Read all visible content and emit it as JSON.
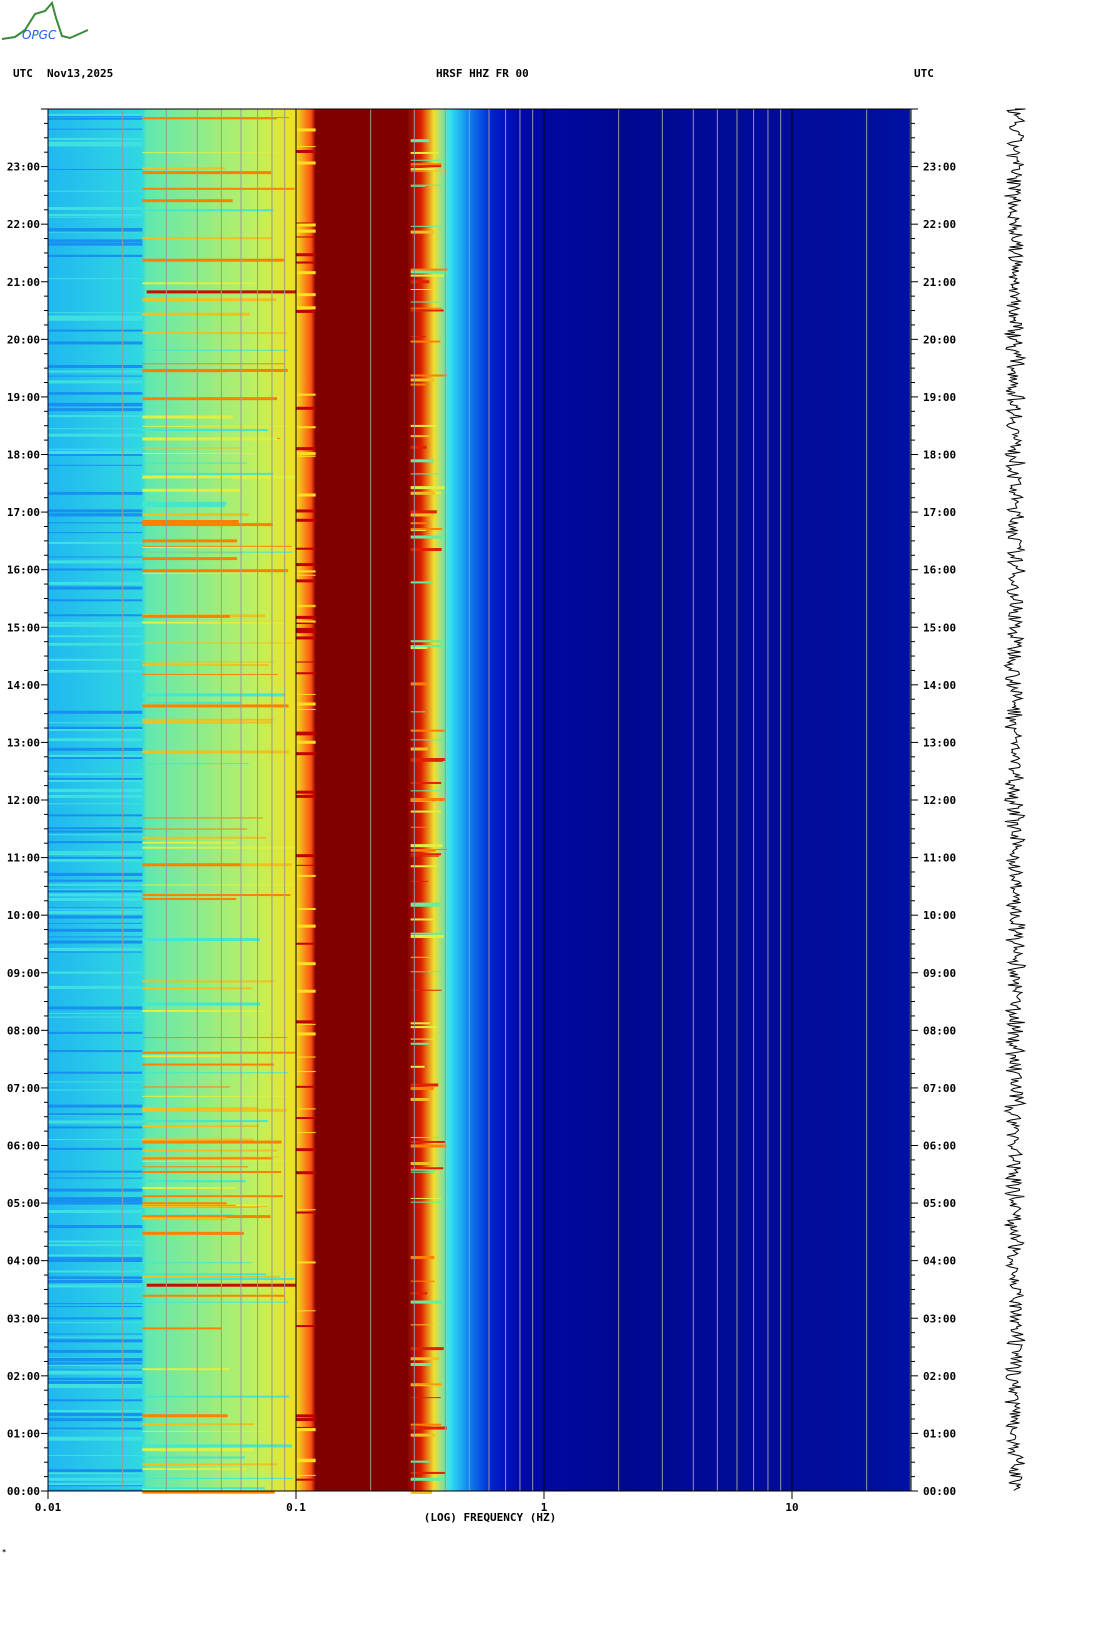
{
  "logo": {
    "text": "OPGC"
  },
  "header": {
    "tz_left": "UTC",
    "date": "Nov13,2025",
    "station": "HRSF HHZ FR 00",
    "tz_right": "UTC"
  },
  "footer_mark": "*",
  "chart_data": {
    "type": "heatmap",
    "title": "HRSF HHZ FR 00",
    "xlabel": "(LOG) FREQUENCY (HZ)",
    "ylabel": "UTC",
    "xscale": "log",
    "xlim": [
      0.01,
      30
    ],
    "ylim_hours": [
      0,
      24
    ],
    "x_ticks": [
      {
        "value": 0.01,
        "label": "0.01"
      },
      {
        "value": 0.1,
        "label": "0.1"
      },
      {
        "value": 1,
        "label": "1"
      },
      {
        "value": 10,
        "label": "10"
      }
    ],
    "y_ticks": [
      "00:00",
      "01:00",
      "02:00",
      "03:00",
      "04:00",
      "05:00",
      "06:00",
      "07:00",
      "08:00",
      "09:00",
      "10:00",
      "11:00",
      "12:00",
      "13:00",
      "14:00",
      "15:00",
      "16:00",
      "17:00",
      "18:00",
      "19:00",
      "20:00",
      "21:00",
      "22:00",
      "23:00"
    ],
    "spectral_profile": [
      {
        "f": 0.01,
        "color": "#20b8f0"
      },
      {
        "f": 0.024,
        "color": "#30d8e0"
      },
      {
        "f": 0.025,
        "color": "#60e8b0"
      },
      {
        "f": 0.07,
        "color": "#c0f060"
      },
      {
        "f": 0.1,
        "color": "#f0e020"
      },
      {
        "f": 0.115,
        "color": "#ff5010"
      },
      {
        "f": 0.12,
        "color": "#800000"
      },
      {
        "f": 0.28,
        "color": "#800000"
      },
      {
        "f": 0.32,
        "color": "#e02000"
      },
      {
        "f": 0.36,
        "color": "#f0e030"
      },
      {
        "f": 0.42,
        "color": "#30e0f0"
      },
      {
        "f": 0.5,
        "color": "#1080f0"
      },
      {
        "f": 0.62,
        "color": "#0020d0"
      },
      {
        "f": 0.8,
        "color": "#0008a8"
      },
      {
        "f": 2,
        "color": "#000890"
      },
      {
        "f": 30,
        "color": "#0010a0"
      }
    ],
    "notable_events_hours": [
      3.6,
      20.85
    ],
    "colormap": "jet"
  }
}
